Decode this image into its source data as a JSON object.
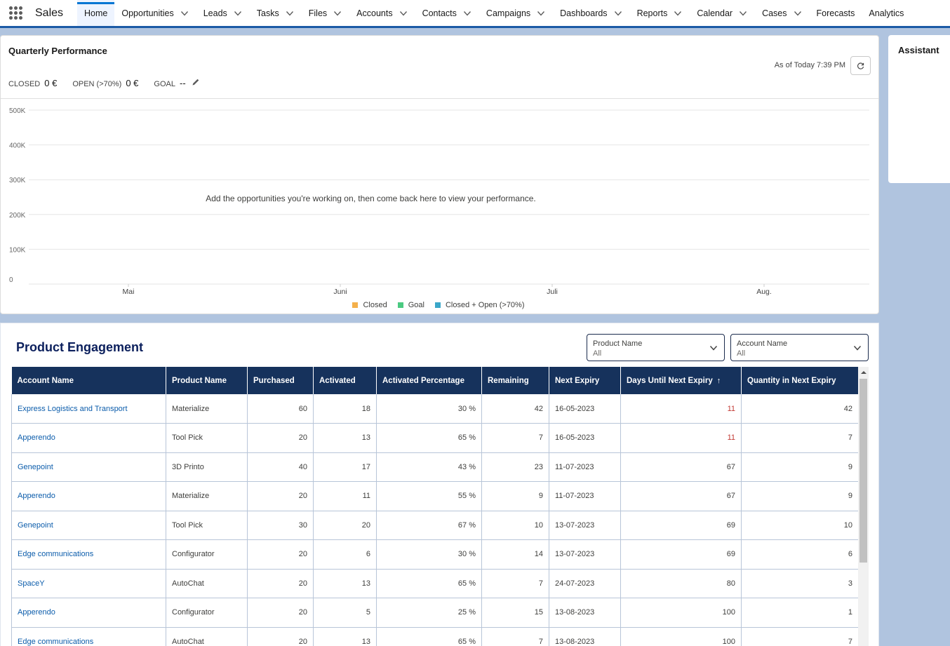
{
  "nav": {
    "app_name": "Sales",
    "items": [
      {
        "label": "Home",
        "dropdown": false,
        "active": true
      },
      {
        "label": "Opportunities",
        "dropdown": true
      },
      {
        "label": "Leads",
        "dropdown": true
      },
      {
        "label": "Tasks",
        "dropdown": true
      },
      {
        "label": "Files",
        "dropdown": true
      },
      {
        "label": "Accounts",
        "dropdown": true
      },
      {
        "label": "Contacts",
        "dropdown": true
      },
      {
        "label": "Campaigns",
        "dropdown": true
      },
      {
        "label": "Dashboards",
        "dropdown": true
      },
      {
        "label": "Reports",
        "dropdown": true
      },
      {
        "label": "Calendar",
        "dropdown": true
      },
      {
        "label": "Cases",
        "dropdown": true
      },
      {
        "label": "Forecasts",
        "dropdown": false
      },
      {
        "label": "Analytics",
        "dropdown": false
      }
    ]
  },
  "quarterly": {
    "title": "Quarterly Performance",
    "as_of": "As of Today 7:39 PM",
    "closed_label": "CLOSED",
    "closed_value": "0 €",
    "open_label": "OPEN (>70%)",
    "open_value": "0 €",
    "goal_label": "GOAL",
    "goal_value": "--",
    "empty_message": "Add the opportunities you're working on, then come back here to view your performance.",
    "legend": [
      {
        "label": "Closed",
        "color": "#f4b04b"
      },
      {
        "label": "Goal",
        "color": "#4bca81"
      },
      {
        "label": "Closed + Open (>70%)",
        "color": "#3ba7c9"
      }
    ]
  },
  "chart_data": {
    "type": "line",
    "categories": [
      "Mai",
      "Juni",
      "Juli",
      "Aug."
    ],
    "y_ticks": [
      "0",
      "100K",
      "200K",
      "300K",
      "400K",
      "500K"
    ],
    "ylim": [
      0,
      500000
    ],
    "series": [],
    "grid": true,
    "legend_position": "bottom"
  },
  "assistant": {
    "title": "Assistant"
  },
  "engagement": {
    "title": "Product Engagement",
    "filters": [
      {
        "label": "Product Name",
        "value": "All"
      },
      {
        "label": "Account Name",
        "value": "All"
      }
    ],
    "columns": [
      "Account Name",
      "Product Name",
      "Purchased",
      "Activated",
      "Activated Percentage",
      "Remaining",
      "Next Expiry",
      "Days Until Next Expiry",
      "Quantity in Next Expiry"
    ],
    "sorted_column_icon": "↑",
    "rows": [
      [
        "Express Logistics and Transport",
        "Materialize",
        "60",
        "18",
        "30 %",
        "42",
        "16-05-2023",
        "11",
        "42"
      ],
      [
        "Apperendo",
        "Tool Pick",
        "20",
        "13",
        "65 %",
        "7",
        "16-05-2023",
        "11",
        "7"
      ],
      [
        "Genepoint",
        "3D Printo",
        "40",
        "17",
        "43 %",
        "23",
        "11-07-2023",
        "67",
        "9"
      ],
      [
        "Apperendo",
        "Materialize",
        "20",
        "11",
        "55 %",
        "9",
        "11-07-2023",
        "67",
        "9"
      ],
      [
        "Genepoint",
        "Tool Pick",
        "30",
        "20",
        "67 %",
        "10",
        "13-07-2023",
        "69",
        "10"
      ],
      [
        "Edge communications",
        "Configurator",
        "20",
        "6",
        "30 %",
        "14",
        "13-07-2023",
        "69",
        "6"
      ],
      [
        "SpaceY",
        "AutoChat",
        "20",
        "13",
        "65 %",
        "7",
        "24-07-2023",
        "80",
        "3"
      ],
      [
        "Apperendo",
        "Configurator",
        "20",
        "5",
        "25 %",
        "15",
        "13-08-2023",
        "100",
        "1"
      ],
      [
        "Edge communications",
        "AutoChat",
        "20",
        "13",
        "65 %",
        "7",
        "13-08-2023",
        "100",
        "7"
      ]
    ],
    "alert_days_threshold": 30
  }
}
